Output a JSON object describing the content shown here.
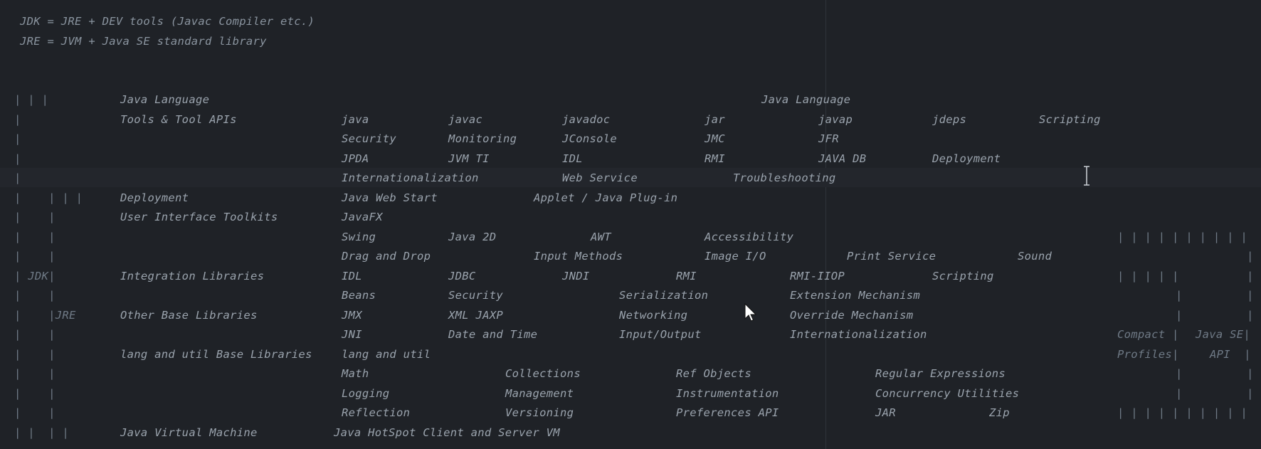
{
  "editor": {
    "comments": [
      "JDK = JRE + DEV tools (Javac Compiler etc.)",
      "JRE = JVM + Java SE standard library"
    ],
    "rows": [
      {
        "items": [
          {
            "text": "| | |",
            "col": "c0"
          },
          {
            "text": "Java Language",
            "col": "c1"
          },
          {
            "text": "Java Language",
            "col": "cJL"
          }
        ]
      },
      {
        "items": [
          {
            "text": "|",
            "col": "c0"
          },
          {
            "text": "Tools & Tool APIs",
            "col": "c1"
          },
          {
            "text": "java",
            "col": "a"
          },
          {
            "text": "javac",
            "col": "b"
          },
          {
            "text": "javadoc",
            "col": "c"
          },
          {
            "text": "jar",
            "col": "d"
          },
          {
            "text": "javap",
            "col": "e"
          },
          {
            "text": "jdeps",
            "col": "f"
          },
          {
            "text": "Scripting",
            "col": "g"
          }
        ]
      },
      {
        "items": [
          {
            "text": "|",
            "col": "c0"
          },
          {
            "text": "Security",
            "col": "a"
          },
          {
            "text": "Monitoring",
            "col": "b"
          },
          {
            "text": "JConsole",
            "col": "c"
          },
          {
            "text": "JMC",
            "col": "d"
          },
          {
            "text": "JFR",
            "col": "e"
          }
        ]
      },
      {
        "items": [
          {
            "text": "|",
            "col": "c0"
          },
          {
            "text": "JPDA",
            "col": "a"
          },
          {
            "text": "JVM TI",
            "col": "b"
          },
          {
            "text": "IDL",
            "col": "c"
          },
          {
            "text": "RMI",
            "col": "d"
          },
          {
            "text": "JAVA DB",
            "col": "e"
          },
          {
            "text": "Deployment",
            "col": "f"
          }
        ]
      },
      {
        "items": [
          {
            "text": "|",
            "col": "c0"
          },
          {
            "text": "Internationalization",
            "col": "a"
          },
          {
            "text": "Web Service",
            "col": "c"
          },
          {
            "text": "Troubleshooting",
            "col": "t1"
          }
        ]
      },
      {
        "items": [
          {
            "text": "|    | | |",
            "col": "c0"
          },
          {
            "text": "Deployment",
            "col": "c1"
          },
          {
            "text": "Java Web Start",
            "col": "a"
          },
          {
            "text": "Applet / Java Plug-in",
            "col": "t2"
          }
        ]
      },
      {
        "items": [
          {
            "text": "|    |",
            "col": "c0"
          },
          {
            "text": "User Interface Toolkits",
            "col": "c1"
          },
          {
            "text": "JavaFX",
            "col": "a"
          }
        ]
      },
      {
        "items": [
          {
            "text": "|    |",
            "col": "c0"
          },
          {
            "text": "Swing",
            "col": "a"
          },
          {
            "text": "Java 2D",
            "col": "b"
          },
          {
            "text": "AWT",
            "col": "t3"
          },
          {
            "text": "Accessibility",
            "col": "d"
          },
          {
            "text": "| | | | | | | | | |",
            "col": "r0"
          }
        ]
      },
      {
        "items": [
          {
            "text": "|    |",
            "col": "c0"
          },
          {
            "text": "Drag and Drop",
            "col": "a"
          },
          {
            "text": "Input Methods",
            "col": "t2"
          },
          {
            "text": "Image I/O",
            "col": "d"
          },
          {
            "text": "Print Service",
            "col": "t4"
          },
          {
            "text": "Sound",
            "col": "t5"
          },
          {
            "text": "|",
            "col": "r9"
          }
        ]
      },
      {
        "items": [
          {
            "text": "| JDK|",
            "col": "c0"
          },
          {
            "text": "Integration Libraries",
            "col": "c1"
          },
          {
            "text": "IDL",
            "col": "a"
          },
          {
            "text": "JDBC",
            "col": "b"
          },
          {
            "text": "JNDI",
            "col": "t6"
          },
          {
            "text": "RMI",
            "col": "t7"
          },
          {
            "text": "RMI-IIOP",
            "col": "t8"
          },
          {
            "text": "Scripting",
            "col": "f"
          },
          {
            "text": "| | | | |",
            "col": "r0"
          },
          {
            "text": "|",
            "col": "r9"
          }
        ]
      },
      {
        "items": [
          {
            "text": "|    |",
            "col": "c0"
          },
          {
            "text": "Beans",
            "col": "a"
          },
          {
            "text": "Security",
            "col": "b"
          },
          {
            "text": "Serialization",
            "col": "t9"
          },
          {
            "text": "Extension Mechanism",
            "col": "t8"
          },
          {
            "text": "|",
            "col": "r5"
          },
          {
            "text": "|",
            "col": "r9"
          }
        ]
      },
      {
        "items": [
          {
            "text": "|    |JRE",
            "col": "c0"
          },
          {
            "text": "Other Base Libraries",
            "col": "c1"
          },
          {
            "text": "JMX",
            "col": "a"
          },
          {
            "text": "XML JAXP",
            "col": "b"
          },
          {
            "text": "Networking",
            "col": "t9"
          },
          {
            "text": "Override Mechanism",
            "col": "t8"
          },
          {
            "text": "|",
            "col": "r5"
          },
          {
            "text": "|",
            "col": "r9"
          }
        ]
      },
      {
        "items": [
          {
            "text": "|    |",
            "col": "c0"
          },
          {
            "text": "JNI",
            "col": "a"
          },
          {
            "text": "Date and Time",
            "col": "b"
          },
          {
            "text": "Input/Output",
            "col": "t9"
          },
          {
            "text": "Internationalization",
            "col": "t8"
          },
          {
            "text": "Compact |",
            "col": "r0"
          },
          {
            "text": "Java SE|",
            "col": "r6"
          }
        ]
      },
      {
        "items": [
          {
            "text": "|    |",
            "col": "c0"
          },
          {
            "text": "lang and util Base Libraries",
            "col": "c1"
          },
          {
            "text": "lang and util",
            "col": "a"
          },
          {
            "text": "Profiles|",
            "col": "r0"
          },
          {
            "text": "API  |",
            "col": "r7"
          }
        ]
      },
      {
        "items": [
          {
            "text": "|    |",
            "col": "c0"
          },
          {
            "text": "Math",
            "col": "a"
          },
          {
            "text": "Collections",
            "col": "t10"
          },
          {
            "text": "Ref Objects",
            "col": "t11"
          },
          {
            "text": "Regular Expressions",
            "col": "t12"
          },
          {
            "text": "|",
            "col": "r5"
          },
          {
            "text": "|",
            "col": "r9"
          }
        ]
      },
      {
        "items": [
          {
            "text": "|    |",
            "col": "c0"
          },
          {
            "text": "Logging",
            "col": "a"
          },
          {
            "text": "Management",
            "col": "t10"
          },
          {
            "text": "Instrumentation",
            "col": "t11"
          },
          {
            "text": "Concurrency Utilities",
            "col": "t12"
          },
          {
            "text": "|",
            "col": "r5"
          },
          {
            "text": "|",
            "col": "r9"
          }
        ]
      },
      {
        "items": [
          {
            "text": "|    |",
            "col": "c0"
          },
          {
            "text": "Reflection",
            "col": "a"
          },
          {
            "text": "Versioning",
            "col": "t10"
          },
          {
            "text": "Preferences API",
            "col": "t11"
          },
          {
            "text": "JAR",
            "col": "t12"
          },
          {
            "text": "Zip",
            "col": "t13"
          },
          {
            "text": "| | | | | | | | | |",
            "col": "r0"
          }
        ]
      },
      {
        "items": [
          {
            "text": "| |  | |",
            "col": "c0"
          },
          {
            "text": "Java Virtual Machine",
            "col": "c1"
          },
          {
            "text": "Java HotSpot Client and Server VM",
            "col": "a2"
          }
        ]
      }
    ]
  }
}
